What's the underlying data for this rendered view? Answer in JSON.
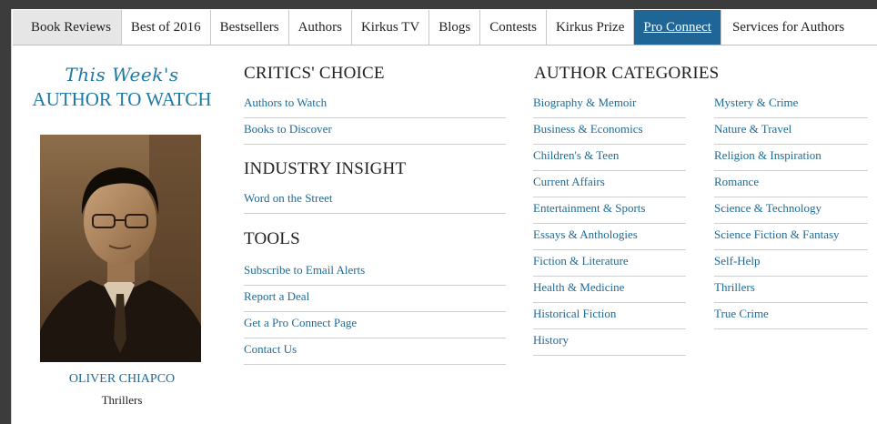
{
  "nav": {
    "tabs": [
      "Book Reviews",
      "Best of 2016",
      "Bestsellers",
      "Authors",
      "Kirkus TV",
      "Blogs",
      "Contests",
      "Kirkus Prize",
      "Pro Connect",
      "Services for Authors"
    ],
    "active_index": 8
  },
  "author_to_watch": {
    "script_heading": "This Week's",
    "heading": "AUTHOR TO WATCH",
    "name": "OLIVER CHIAPCO",
    "genre": "Thrillers"
  },
  "critics_choice": {
    "heading": "CRITICS' CHOICE",
    "links": [
      "Authors to Watch",
      "Books to Discover"
    ]
  },
  "industry_insight": {
    "heading": "INDUSTRY INSIGHT",
    "links": [
      "Word on the Street"
    ]
  },
  "tools": {
    "heading": "TOOLS",
    "links": [
      "Subscribe to Email Alerts",
      "Report a Deal",
      "Get a Pro Connect Page",
      "Contact Us"
    ]
  },
  "author_categories": {
    "heading": "AUTHOR CATEGORIES",
    "col1": [
      "Biography & Memoir",
      "Business & Economics",
      "Children's & Teen",
      "Current Affairs",
      "Entertainment & Sports",
      "Essays & Anthologies",
      "Fiction & Literature",
      "Health & Medicine",
      "Historical Fiction",
      "History"
    ],
    "col2": [
      "Mystery & Crime",
      "Nature & Travel",
      "Religion & Inspiration",
      "Romance",
      "Science & Technology",
      "Science Fiction & Fantasy",
      "Self-Help",
      "Thrillers",
      "True Crime"
    ]
  },
  "colors": {
    "link": "#1e6a97",
    "accent": "#1e7aa6",
    "active_tab": "#1f6696"
  }
}
